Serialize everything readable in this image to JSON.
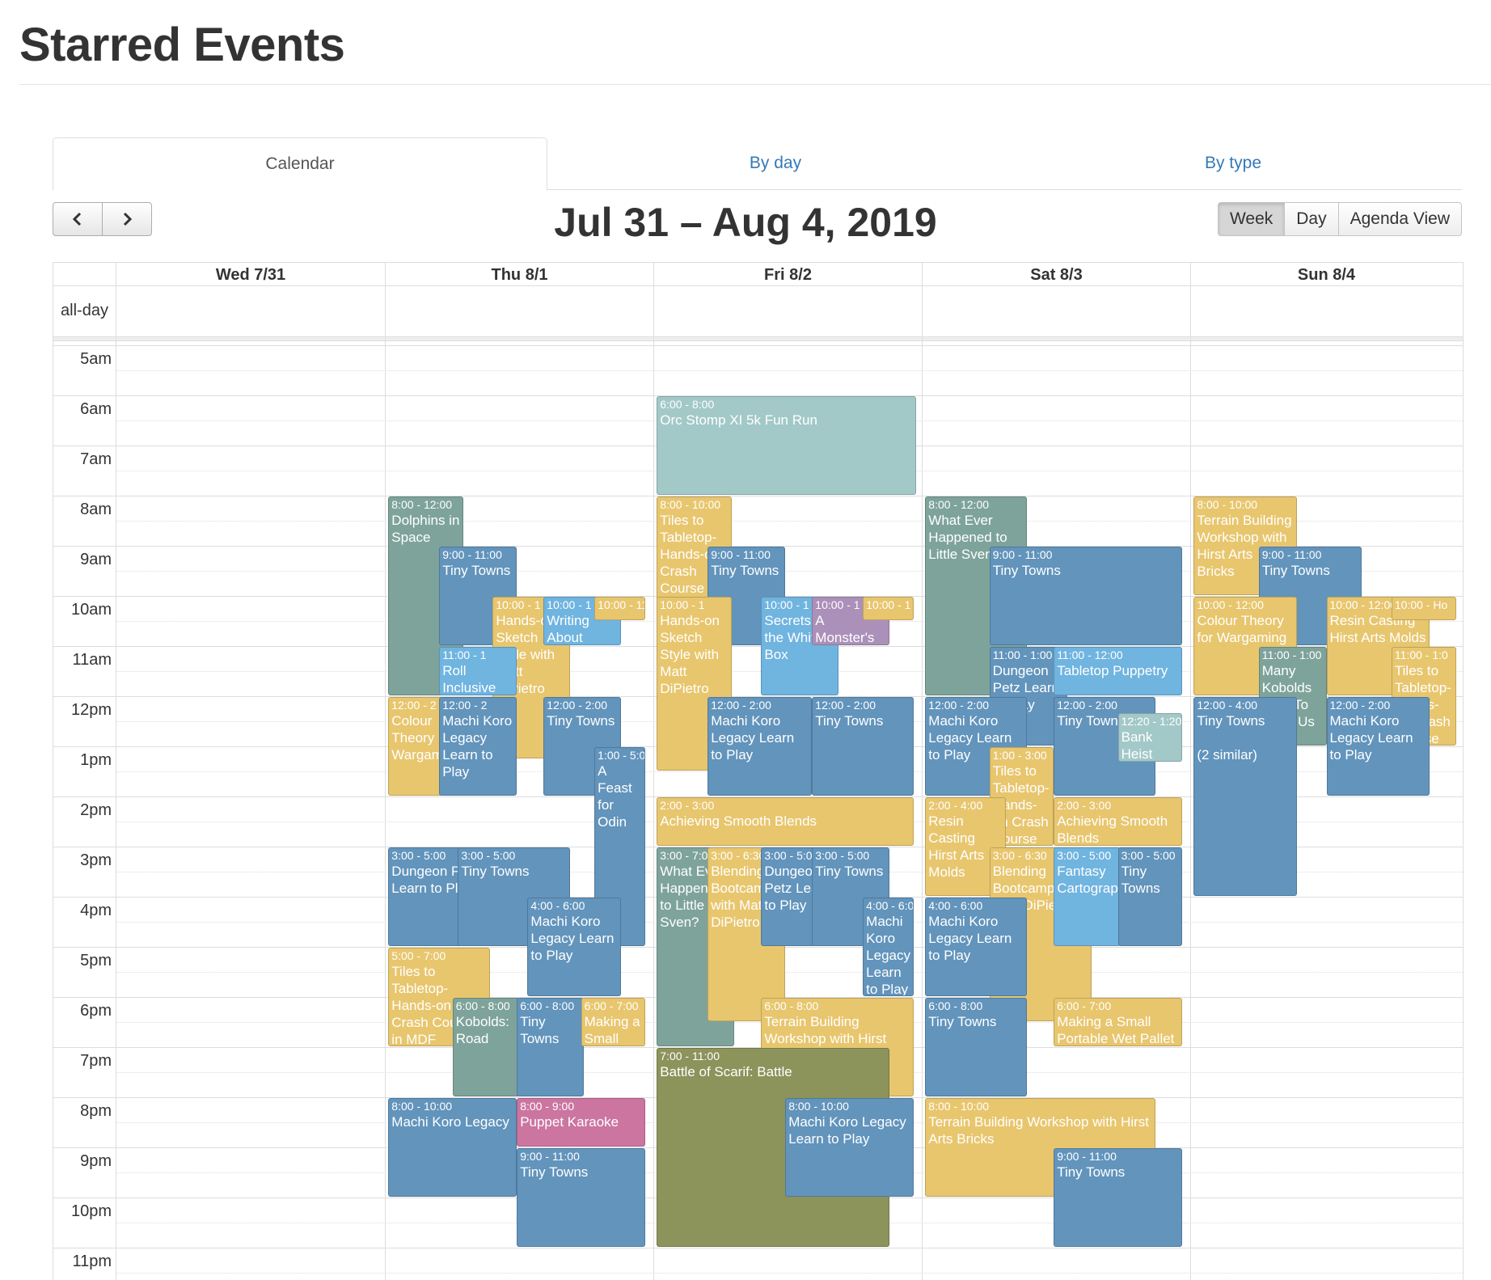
{
  "page": {
    "title": "Starred Events"
  },
  "tabs": [
    {
      "label": "Calendar"
    },
    {
      "label": "By day"
    },
    {
      "label": "By type"
    }
  ],
  "toolbar": {
    "title": "Jul 31 – Aug 4, 2019",
    "prev_icon": "chevron-left-icon",
    "next_icon": "chevron-right-icon",
    "views": [
      "Week",
      "Day",
      "Agenda View"
    ],
    "active_view": "Week"
  },
  "calendar": {
    "days": [
      "Wed 7/31",
      "Thu 8/1",
      "Fri 8/2",
      "Sat 8/3",
      "Sun 8/4"
    ],
    "allday_label": "all-day",
    "hours": [
      "5am",
      "6am",
      "7am",
      "8am",
      "9am",
      "10am",
      "11am",
      "12pm",
      "1pm",
      "2pm",
      "3pm",
      "4pm",
      "5pm",
      "6pm",
      "7pm",
      "8pm",
      "9pm",
      "10pm",
      "11pm"
    ]
  },
  "colors": {
    "blue": "#6294bc",
    "yellow": "#e8c66e",
    "sage": "#7ea39a",
    "teal": "#a3c8c8",
    "light_blue": "#70b4e0",
    "purple": "#ab90b9",
    "pink": "#cb75a0",
    "olive": "#8c935b",
    "link": "#337ab7"
  },
  "events": [
    {
      "day": 2,
      "start": 6,
      "end": 8,
      "time": "6:00 - 8:00",
      "title": "Orc Stomp XI 5k Fun Run",
      "color": "teal"
    },
    {
      "day": 1,
      "start": 8,
      "end": 12,
      "time": "8:00 - 12:00",
      "title": "Dolphins in Space",
      "color": "sage"
    },
    {
      "day": 1,
      "start": 9,
      "end": 11,
      "time": "9:00 - 11:00",
      "title": "Tiny Towns",
      "color": "blue"
    },
    {
      "day": 1,
      "start": 10,
      "end": 13.25,
      "time": "10:00 - 1",
      "title": "Hands-on Sketch Style with Matt DiPietro",
      "color": "yellow"
    },
    {
      "day": 1,
      "start": 10,
      "end": 11,
      "time": "10:00 - 1",
      "title": "Writing About",
      "color": "light_blue"
    },
    {
      "day": 1,
      "start": 10,
      "end": 10.5,
      "time": "10:00 - 11",
      "title": "",
      "color": "yellow"
    },
    {
      "day": 1,
      "start": 11,
      "end": 12,
      "time": "11:00 - 1",
      "title": "Roll Inclusive",
      "color": "light_blue"
    },
    {
      "day": 1,
      "start": 12,
      "end": 14,
      "time": "12:00 - 2",
      "title": "Colour Theory Wargaming",
      "color": "yellow"
    },
    {
      "day": 1,
      "start": 12,
      "end": 14,
      "time": "12:00 - 2",
      "title": "Machi Koro Legacy Learn to Play",
      "color": "blue"
    },
    {
      "day": 1,
      "start": 12,
      "end": 14,
      "time": "12:00 - 2:00",
      "title": "Tiny Towns",
      "color": "blue"
    },
    {
      "day": 1,
      "start": 13,
      "end": 17,
      "time": "1:00 - 5:00",
      "title": "A Feast for Odin",
      "color": "blue"
    },
    {
      "day": 1,
      "start": 15,
      "end": 17,
      "time": "3:00 - 5:00",
      "title": "Dungeon Petz Learn to Play",
      "color": "blue"
    },
    {
      "day": 1,
      "start": 15,
      "end": 17,
      "time": "3:00 - 5:00",
      "title": "Tiny Towns",
      "color": "blue"
    },
    {
      "day": 1,
      "start": 16,
      "end": 18,
      "time": "4:00 - 6:00",
      "title": "Machi Koro Legacy Learn to Play",
      "color": "blue"
    },
    {
      "day": 1,
      "start": 17,
      "end": 19,
      "time": "5:00 - 7:00",
      "title": "Tiles to Tabletop-Hands-on Crash Course in MDF",
      "color": "yellow"
    },
    {
      "day": 1,
      "start": 18,
      "end": 20,
      "time": "6:00 - 8:00",
      "title": "Kobolds: Road",
      "color": "sage"
    },
    {
      "day": 1,
      "start": 18,
      "end": 20,
      "time": "6:00 - 8:00",
      "title": "Tiny Towns",
      "color": "blue"
    },
    {
      "day": 1,
      "start": 18,
      "end": 19,
      "time": "6:00 - 7:00",
      "title": "Making a Small",
      "color": "yellow"
    },
    {
      "day": 1,
      "start": 20,
      "end": 22,
      "time": "8:00 - 10:00",
      "title": "Machi Koro Legacy",
      "color": "blue"
    },
    {
      "day": 1,
      "start": 20,
      "end": 21,
      "time": "8:00 - 9:00",
      "title": "Puppet Karaoke",
      "color": "pink"
    },
    {
      "day": 1,
      "start": 21,
      "end": 23,
      "time": "9:00 - 11:00",
      "title": "Tiny Towns",
      "color": "blue"
    },
    {
      "day": 2,
      "start": 8,
      "end": 13.5,
      "time": "8:00 - 10:00",
      "title": "Tiles to Tabletop-Hands-on Crash Course",
      "color": "yellow"
    },
    {
      "day": 2,
      "start": 9,
      "end": 11,
      "time": "9:00 - 11:00",
      "title": "Tiny Towns",
      "color": "blue"
    },
    {
      "day": 2,
      "start": 10,
      "end": 13.5,
      "time": "10:00 - 1",
      "title": "Hands-on Sketch Style with Matt DiPietro",
      "color": "yellow"
    },
    {
      "day": 2,
      "start": 10,
      "end": 12,
      "time": "10:00 - 1",
      "title": "Secrets of the White Box",
      "color": "light_blue"
    },
    {
      "day": 2,
      "start": 10,
      "end": 11,
      "time": "10:00 - 1",
      "title": "A Monster's",
      "color": "purple"
    },
    {
      "day": 2,
      "start": 10,
      "end": 10.5,
      "time": "10:00 - 1",
      "title": "",
      "color": "yellow"
    },
    {
      "day": 2,
      "start": 12,
      "end": 14,
      "time": "12:00 - 2:00",
      "title": "Machi Koro Legacy Learn to Play",
      "color": "blue"
    },
    {
      "day": 2,
      "start": 12,
      "end": 14,
      "time": "12:00 - 2:00",
      "title": "Tiny Towns",
      "color": "blue"
    },
    {
      "day": 2,
      "start": 14,
      "end": 15,
      "time": "2:00 - 3:00",
      "title": "Achieving Smooth Blends",
      "color": "yellow"
    },
    {
      "day": 2,
      "start": 15,
      "end": 19,
      "time": "3:00 - 7:00",
      "title": "What Ever Happened to Little Sven?",
      "color": "sage"
    },
    {
      "day": 2,
      "start": 15,
      "end": 18.5,
      "time": "3:00 - 6:30",
      "title": "Blending Bootcamp with Matt DiPietro",
      "color": "yellow"
    },
    {
      "day": 2,
      "start": 15,
      "end": 17,
      "time": "3:00 - 5:00",
      "title": "Dungeon Petz Learn to Play",
      "color": "blue"
    },
    {
      "day": 2,
      "start": 15,
      "end": 17,
      "time": "3:00 - 5:00",
      "title": "Tiny Towns",
      "color": "blue"
    },
    {
      "day": 2,
      "start": 16,
      "end": 18,
      "time": "4:00 - 6:00",
      "title": "Machi Koro Legacy Learn to Play",
      "color": "blue"
    },
    {
      "day": 2,
      "start": 18,
      "end": 20,
      "time": "6:00 - 8:00",
      "title": "Terrain Building Workshop with Hirst Arts Bricks",
      "color": "yellow"
    },
    {
      "day": 2,
      "start": 19,
      "end": 23,
      "time": "7:00 - 11:00",
      "title": "Battle of Scarif: Battle",
      "color": "olive"
    },
    {
      "day": 2,
      "start": 20,
      "end": 22,
      "time": "8:00 - 10:00",
      "title": "Machi Koro Legacy Learn to Play",
      "color": "blue"
    },
    {
      "day": 3,
      "start": 8,
      "end": 12,
      "time": "8:00 - 12:00",
      "title": "What Ever Happened to Little Sven?",
      "color": "sage"
    },
    {
      "day": 3,
      "start": 9,
      "end": 11,
      "time": "9:00 - 11:00",
      "title": "Tiny Towns",
      "color": "blue"
    },
    {
      "day": 3,
      "start": 11,
      "end": 13,
      "time": "11:00 - 1:00",
      "title": "Dungeon Petz Learn to Play",
      "color": "blue"
    },
    {
      "day": 3,
      "start": 11,
      "end": 12,
      "time": "11:00 - 12:00",
      "title": "Tabletop Puppetry",
      "color": "light_blue"
    },
    {
      "day": 3,
      "start": 12,
      "end": 14,
      "time": "12:00 - 2:00",
      "title": "Machi Koro Legacy Learn to Play",
      "color": "blue"
    },
    {
      "day": 3,
      "start": 12,
      "end": 14,
      "time": "12:00 - 2:00",
      "title": "Tiny Towns",
      "color": "blue"
    },
    {
      "day": 3,
      "start": 12.33,
      "end": 13.33,
      "time": "12:20 - 1:20",
      "title": "Bank Heist",
      "color": "teal"
    },
    {
      "day": 3,
      "start": 13,
      "end": 15,
      "time": "1:00 - 3:00",
      "title": "Tiles to Tabletop-Hands-on Crash Course in MDF",
      "color": "yellow"
    },
    {
      "day": 3,
      "start": 14,
      "end": 16,
      "time": "2:00 - 4:00",
      "title": "Resin Casting Hirst Arts Molds",
      "color": "yellow"
    },
    {
      "day": 3,
      "start": 14,
      "end": 15,
      "time": "2:00 - 3:00",
      "title": "Achieving Smooth Blends",
      "color": "yellow"
    },
    {
      "day": 3,
      "start": 15,
      "end": 18.5,
      "time": "3:00 - 6:30",
      "title": "Blending Bootcamp with Matt DiPietro",
      "color": "yellow"
    },
    {
      "day": 3,
      "start": 15,
      "end": 17,
      "time": "3:00 - 5:00",
      "title": "Fantasy Cartography",
      "color": "light_blue"
    },
    {
      "day": 3,
      "start": 15,
      "end": 17,
      "time": "3:00 - 5:00",
      "title": "Tiny Towns",
      "color": "blue"
    },
    {
      "day": 3,
      "start": 16,
      "end": 18,
      "time": "4:00 - 6:00",
      "title": "Machi Koro Legacy Learn to Play",
      "color": "blue"
    },
    {
      "day": 3,
      "start": 18,
      "end": 20,
      "time": "6:00 - 8:00",
      "title": "Tiny Towns",
      "color": "blue"
    },
    {
      "day": 3,
      "start": 18,
      "end": 19,
      "time": "6:00 - 7:00",
      "title": "Making a Small Portable Wet Pallet",
      "color": "yellow"
    },
    {
      "day": 3,
      "start": 20,
      "end": 22,
      "time": "8:00 - 10:00",
      "title": "Terrain Building Workshop with Hirst Arts Bricks",
      "color": "yellow"
    },
    {
      "day": 3,
      "start": 21,
      "end": 23,
      "time": "9:00 - 11:00",
      "title": "Tiny Towns",
      "color": "blue"
    },
    {
      "day": 4,
      "start": 8,
      "end": 10,
      "time": "8:00 - 10:00",
      "title": "Terrain Building Workshop with Hirst Arts Bricks",
      "color": "yellow"
    },
    {
      "day": 4,
      "start": 9,
      "end": 11,
      "time": "9:00 - 11:00",
      "title": "Tiny Towns",
      "color": "blue"
    },
    {
      "day": 4,
      "start": 10,
      "end": 12,
      "time": "10:00 - 12:00",
      "title": "Colour Theory for Wargaming",
      "color": "yellow"
    },
    {
      "day": 4,
      "start": 10,
      "end": 12,
      "time": "10:00 - 12:00",
      "title": "Resin Casting Hirst Arts Molds",
      "color": "yellow"
    },
    {
      "day": 4,
      "start": 10,
      "end": 10.5,
      "time": "10:00 - Ho",
      "title": "",
      "color": "yellow"
    },
    {
      "day": 4,
      "start": 11,
      "end": 13,
      "time": "11:00 - 1:00",
      "title": "Many Kobolds Died To Bring Us This Information: Star Wars",
      "color": "sage"
    },
    {
      "day": 4,
      "start": 11,
      "end": 13,
      "time": "11:00 - 1:0",
      "title": "Tiles to Tabletop-Hands-on Crash Course",
      "color": "yellow"
    },
    {
      "day": 4,
      "start": 12,
      "end": 16,
      "time": "12:00 - 4:00",
      "title": "Tiny Towns\n\n(2 similar)",
      "color": "blue"
    },
    {
      "day": 4,
      "start": 12,
      "end": 14,
      "time": "12:00 - 2:00",
      "title": "Machi Koro Legacy Learn to Play",
      "color": "blue"
    }
  ]
}
